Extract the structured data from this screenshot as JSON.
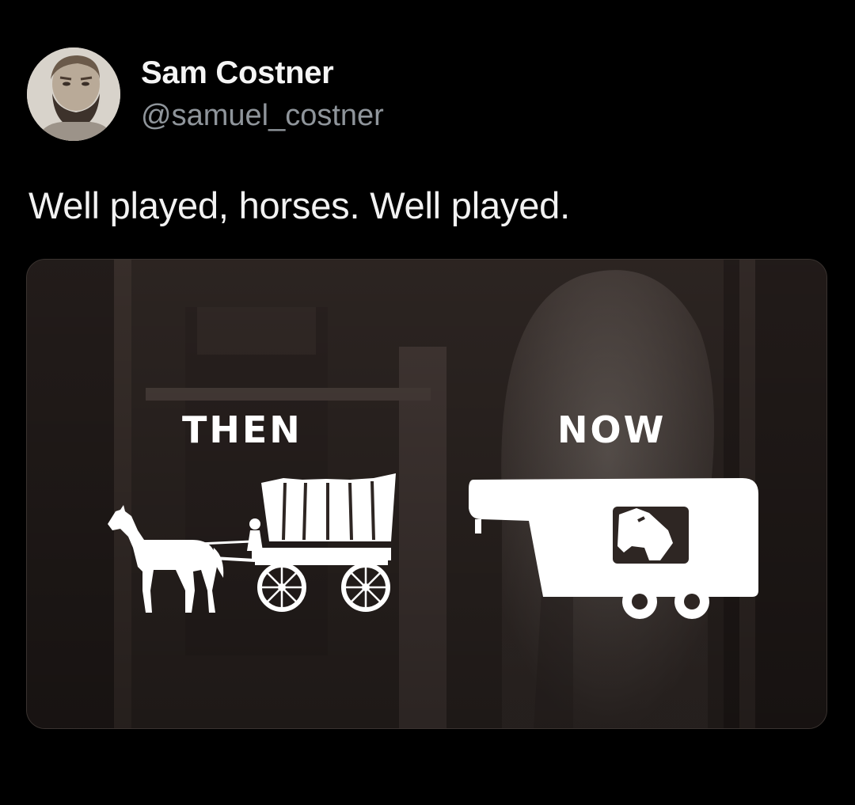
{
  "tweet": {
    "author": {
      "display_name": "Sam Costner",
      "handle": "@samuel_costner"
    },
    "text": "Well played, horses. Well played."
  },
  "media": {
    "then_label": "THEN",
    "now_label": "NOW",
    "then_icon": "horse-drawn-covered-wagon-icon",
    "now_icon": "horse-trailer-icon"
  },
  "colors": {
    "background": "#000000",
    "text_primary": "#f2f2f2",
    "text_secondary": "#8f959b",
    "media_overlay": "#2c2421",
    "icon_fill": "#ffffff"
  }
}
